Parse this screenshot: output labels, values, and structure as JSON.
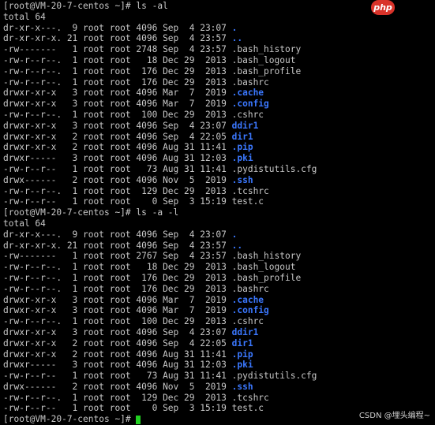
{
  "prompt_1": {
    "prefix": "[root@VM-20-7-centos ~]# ",
    "command": "ls -al"
  },
  "total_1": "total 64",
  "listing_1": [
    {
      "meta": "dr-xr-x---.  9 root root 4096 Sep  4 23:07 ",
      "name": ".",
      "is_dir": true
    },
    {
      "meta": "dr-xr-xr-x. 21 root root 4096 Sep  4 23:57 ",
      "name": "..",
      "is_dir": true
    },
    {
      "meta": "-rw-------   1 root root 2748 Sep  4 23:57 ",
      "name": ".bash_history",
      "is_dir": false
    },
    {
      "meta": "-rw-r--r--.  1 root root   18 Dec 29  2013 ",
      "name": ".bash_logout",
      "is_dir": false
    },
    {
      "meta": "-rw-r--r--.  1 root root  176 Dec 29  2013 ",
      "name": ".bash_profile",
      "is_dir": false
    },
    {
      "meta": "-rw-r--r--.  1 root root  176 Dec 29  2013 ",
      "name": ".bashrc",
      "is_dir": false
    },
    {
      "meta": "drwxr-xr-x   3 root root 4096 Mar  7  2019 ",
      "name": ".cache",
      "is_dir": true
    },
    {
      "meta": "drwxr-xr-x   3 root root 4096 Mar  7  2019 ",
      "name": ".config",
      "is_dir": true
    },
    {
      "meta": "-rw-r--r--.  1 root root  100 Dec 29  2013 ",
      "name": ".cshrc",
      "is_dir": false
    },
    {
      "meta": "drwxr-xr-x   3 root root 4096 Sep  4 23:07 ",
      "name": "ddir1",
      "is_dir": true
    },
    {
      "meta": "drwxr-xr-x   2 root root 4096 Sep  4 22:05 ",
      "name": "dir1",
      "is_dir": true
    },
    {
      "meta": "drwxr-xr-x   2 root root 4096 Aug 31 11:41 ",
      "name": ".pip",
      "is_dir": true
    },
    {
      "meta": "drwxr-----   3 root root 4096 Aug 31 12:03 ",
      "name": ".pki",
      "is_dir": true
    },
    {
      "meta": "-rw-r--r--   1 root root   73 Aug 31 11:41 ",
      "name": ".pydistutils.cfg",
      "is_dir": false
    },
    {
      "meta": "drwx------   2 root root 4096 Nov  5  2019 ",
      "name": ".ssh",
      "is_dir": true
    },
    {
      "meta": "-rw-r--r--.  1 root root  129 Dec 29  2013 ",
      "name": ".tcshrc",
      "is_dir": false
    },
    {
      "meta": "-rw-r--r--   1 root root    0 Sep  3 15:19 ",
      "name": "test.c",
      "is_dir": false
    }
  ],
  "prompt_2": {
    "prefix": "[root@VM-20-7-centos ~]# ",
    "command": "ls -a -l"
  },
  "total_2": "total 64",
  "listing_2": [
    {
      "meta": "dr-xr-x---.  9 root root 4096 Sep  4 23:07 ",
      "name": ".",
      "is_dir": true
    },
    {
      "meta": "dr-xr-xr-x. 21 root root 4096 Sep  4 23:57 ",
      "name": "..",
      "is_dir": true
    },
    {
      "meta": "-rw-------   1 root root 2767 Sep  4 23:57 ",
      "name": ".bash_history",
      "is_dir": false
    },
    {
      "meta": "-rw-r--r--.  1 root root   18 Dec 29  2013 ",
      "name": ".bash_logout",
      "is_dir": false
    },
    {
      "meta": "-rw-r--r--.  1 root root  176 Dec 29  2013 ",
      "name": ".bash_profile",
      "is_dir": false
    },
    {
      "meta": "-rw-r--r--.  1 root root  176 Dec 29  2013 ",
      "name": ".bashrc",
      "is_dir": false
    },
    {
      "meta": "drwxr-xr-x   3 root root 4096 Mar  7  2019 ",
      "name": ".cache",
      "is_dir": true
    },
    {
      "meta": "drwxr-xr-x   3 root root 4096 Mar  7  2019 ",
      "name": ".config",
      "is_dir": true
    },
    {
      "meta": "-rw-r--r--.  1 root root  100 Dec 29  2013 ",
      "name": ".cshrc",
      "is_dir": false
    },
    {
      "meta": "drwxr-xr-x   3 root root 4096 Sep  4 23:07 ",
      "name": "ddir1",
      "is_dir": true
    },
    {
      "meta": "drwxr-xr-x   2 root root 4096 Sep  4 22:05 ",
      "name": "dir1",
      "is_dir": true
    },
    {
      "meta": "drwxr-xr-x   2 root root 4096 Aug 31 11:41 ",
      "name": ".pip",
      "is_dir": true
    },
    {
      "meta": "drwxr-----   3 root root 4096 Aug 31 12:03 ",
      "name": ".pki",
      "is_dir": true
    },
    {
      "meta": "-rw-r--r--   1 root root   73 Aug 31 11:41 ",
      "name": ".pydistutils.cfg",
      "is_dir": false
    },
    {
      "meta": "drwx------   2 root root 4096 Nov  5  2019 ",
      "name": ".ssh",
      "is_dir": true
    },
    {
      "meta": "-rw-r--r--.  1 root root  129 Dec 29  2013 ",
      "name": ".tcshrc",
      "is_dir": false
    },
    {
      "meta": "-rw-r--r--   1 root root    0 Sep  3 15:19 ",
      "name": "test.c",
      "is_dir": false
    }
  ],
  "prompt_3": {
    "prefix": "[root@VM-20-7-centos ~]# ",
    "command": ""
  },
  "badge": {
    "text": "php"
  },
  "watermark": {
    "text": "CSDN @埋头编程~"
  },
  "colors": {
    "background": "#000000",
    "text": "#c8c8c8",
    "directory": "#3b78ff",
    "cursor": "#21d021",
    "badge": "#d9332a"
  }
}
